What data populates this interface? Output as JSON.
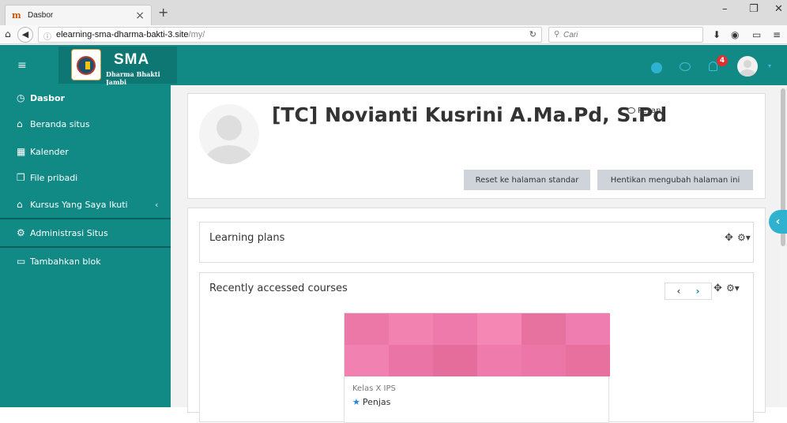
{
  "browser": {
    "tab_title": "Dasbor",
    "tab_close": "×",
    "new_tab": "+",
    "url_host": "elearning-sma-dharma-bakti-3.site",
    "url_path": "/my/",
    "search_placeholder": "Cari"
  },
  "header": {
    "brand_title": "SMA",
    "brand_subtitle": "Dharma Bhakti Jambi",
    "notification_count": "4"
  },
  "sidebar": {
    "items": [
      {
        "label": "Dasbor"
      },
      {
        "label": "Beranda situs"
      },
      {
        "label": "Kalender"
      },
      {
        "label": "File pribadi"
      },
      {
        "label": "Kursus Yang Saya Ikuti"
      },
      {
        "label": "Administrasi Situs"
      },
      {
        "label": "Tambahkan blok"
      }
    ]
  },
  "profile": {
    "name": "[TC] Novianti Kusrini A.Ma.Pd, S.Pd",
    "message_label": "Pesan",
    "reset_button": "Reset ke halaman standar",
    "stop_button": "Hentikan mengubah halaman ini"
  },
  "blocks": {
    "learning_plans_title": "Learning plans",
    "recent_courses_title": "Recently accessed courses"
  },
  "course": {
    "category": "Kelas X IPS",
    "name": "Penjas"
  },
  "colors": {
    "brand_teal": "#118a86",
    "accent_cyan": "#2fb2cf",
    "badge_red": "#e02f2f",
    "mosaic": [
      "#ec78a8",
      "#f283b0",
      "#ee7aac",
      "#f487b3",
      "#e8729f",
      "#f07db0",
      "#f181b1",
      "#ea74a6",
      "#e56d9c",
      "#ef7bad",
      "#eb76a7",
      "#e8709f"
    ]
  }
}
